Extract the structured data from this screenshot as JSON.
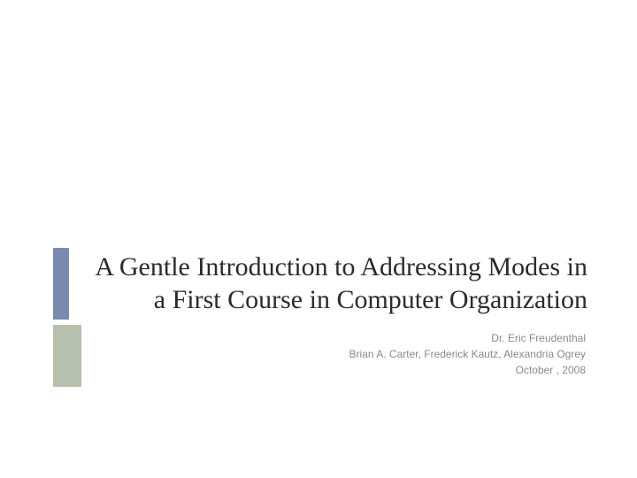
{
  "slide": {
    "title": "A Gentle Introduction to Addressing Modes in a First Course in Computer Organization",
    "author_primary": "Dr. Eric Freudenthal",
    "author_secondary": "Brian A. Carter, Frederick Kautz, Alexandria Ogrey",
    "date": "October , 2008"
  }
}
